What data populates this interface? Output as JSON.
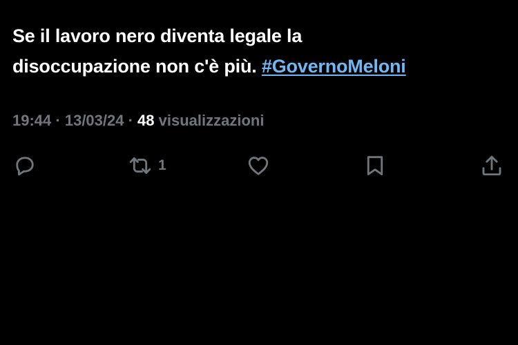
{
  "tweet": {
    "text_line1": "Se il lavoro nero diventa legale la",
    "text_line2_prefix": "disoccupazione non c'è più. ",
    "hashtag": "#GovernoMeloni"
  },
  "meta": {
    "time": "19:44",
    "separator1": " · ",
    "date": "13/03/24",
    "separator2": " · ",
    "views_count": "48",
    "views_label": " visualizzazioni"
  },
  "actions": {
    "reply": {
      "icon": "reply-icon"
    },
    "repost": {
      "icon": "repost-icon",
      "count": "1"
    },
    "like": {
      "icon": "heart-icon"
    },
    "bookmark": {
      "icon": "bookmark-icon"
    },
    "share": {
      "icon": "share-icon"
    }
  },
  "colors": {
    "background": "#000000",
    "text": "#ffffff",
    "secondary": "#71767b",
    "link": "#6fb8f5"
  }
}
